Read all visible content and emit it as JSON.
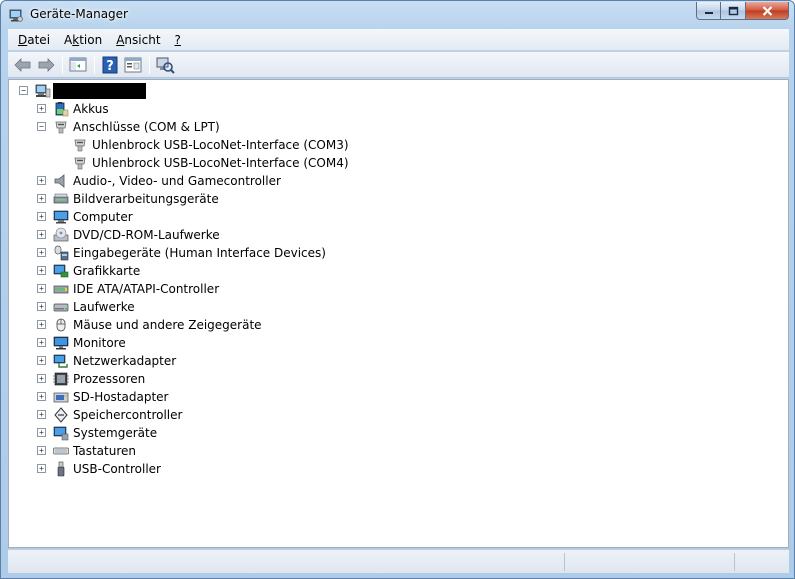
{
  "window": {
    "title": "Geräte-Manager",
    "caption_buttons": [
      "minimize",
      "maximize",
      "close"
    ]
  },
  "menu": [
    {
      "label": "Datei",
      "accel": "D"
    },
    {
      "label": "Aktion",
      "accel": "k"
    },
    {
      "label": "Ansicht",
      "accel": "A"
    },
    {
      "label": "?",
      "accel": "?"
    }
  ],
  "toolbar": [
    {
      "name": "back-icon"
    },
    {
      "name": "forward-icon"
    },
    {
      "name": "separator"
    },
    {
      "name": "show-hide-console-tree-icon"
    },
    {
      "name": "separator"
    },
    {
      "name": "help-icon"
    },
    {
      "name": "properties-icon"
    },
    {
      "name": "separator"
    },
    {
      "name": "scan-hardware-icon"
    }
  ],
  "tree": {
    "root": {
      "label": "",
      "redacted": true,
      "icon": "computer-root-icon",
      "expanded": true
    },
    "categories": [
      {
        "label": "Akkus",
        "icon": "battery-icon",
        "expanded": false
      },
      {
        "label": "Anschlüsse (COM & LPT)",
        "icon": "port-icon",
        "expanded": true,
        "children": [
          {
            "label": "Uhlenbrock USB-LocoNet-Interface (COM3)",
            "icon": "port-icon"
          },
          {
            "label": "Uhlenbrock USB-LocoNet-Interface (COM4)",
            "icon": "port-icon"
          }
        ]
      },
      {
        "label": "Audio-, Video- und Gamecontroller",
        "icon": "speaker-icon",
        "expanded": false
      },
      {
        "label": "Bildverarbeitungsgeräte",
        "icon": "scanner-icon",
        "expanded": false
      },
      {
        "label": "Computer",
        "icon": "computer-icon",
        "expanded": false
      },
      {
        "label": "DVD/CD-ROM-Laufwerke",
        "icon": "dvd-drive-icon",
        "expanded": false
      },
      {
        "label": "Eingabegeräte (Human Interface Devices)",
        "icon": "hid-icon",
        "expanded": false
      },
      {
        "label": "Grafikkarte",
        "icon": "display-adapter-icon",
        "expanded": false
      },
      {
        "label": "IDE ATA/ATAPI-Controller",
        "icon": "ide-controller-icon",
        "expanded": false
      },
      {
        "label": "Laufwerke",
        "icon": "disk-drive-icon",
        "expanded": false
      },
      {
        "label": "Mäuse und andere Zeigegeräte",
        "icon": "mouse-icon",
        "expanded": false
      },
      {
        "label": "Monitore",
        "icon": "monitor-icon",
        "expanded": false
      },
      {
        "label": "Netzwerkadapter",
        "icon": "network-adapter-icon",
        "expanded": false
      },
      {
        "label": "Prozessoren",
        "icon": "processor-icon",
        "expanded": false
      },
      {
        "label": "SD-Hostadapter",
        "icon": "sd-host-icon",
        "expanded": false
      },
      {
        "label": "Speichercontroller",
        "icon": "storage-controller-icon",
        "expanded": false
      },
      {
        "label": "Systemgeräte",
        "icon": "system-device-icon",
        "expanded": false
      },
      {
        "label": "Tastaturen",
        "icon": "keyboard-icon",
        "expanded": false
      },
      {
        "label": "USB-Controller",
        "icon": "usb-icon",
        "expanded": false
      }
    ]
  },
  "status": {
    "panes": [
      "",
      "",
      ""
    ]
  }
}
